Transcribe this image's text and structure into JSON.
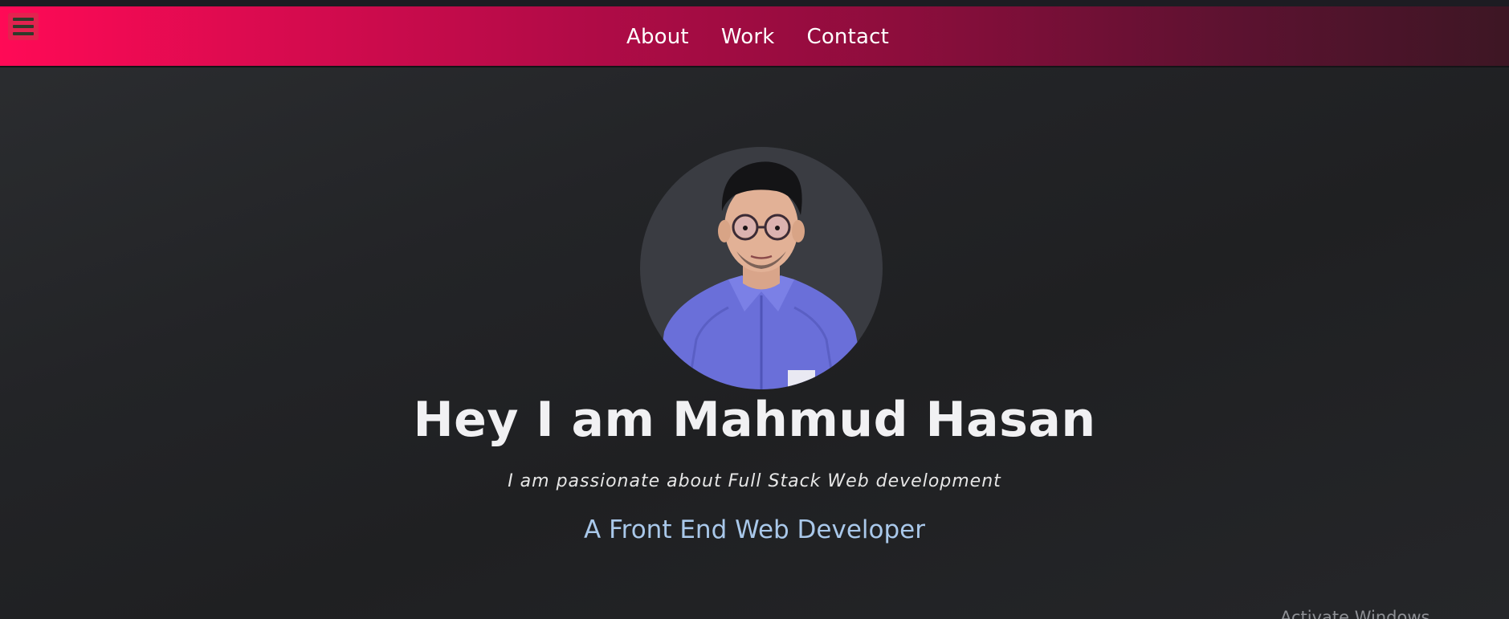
{
  "nav": {
    "menu_icon": "hamburger-menu-icon",
    "links": [
      {
        "label": "About"
      },
      {
        "label": "Work"
      },
      {
        "label": "Contact"
      }
    ]
  },
  "hero": {
    "title": "Hey I am Mahmud Hasan",
    "subtitle": "I am passionate about Full Stack Web development",
    "role": "A Front End Web Developer"
  },
  "system": {
    "watermark": "Activate Windows"
  },
  "colors": {
    "nav_gradient_start": "#ff0a56",
    "nav_gradient_end": "#3d1624",
    "role_text": "#a9c8ea",
    "background": "#232427"
  }
}
